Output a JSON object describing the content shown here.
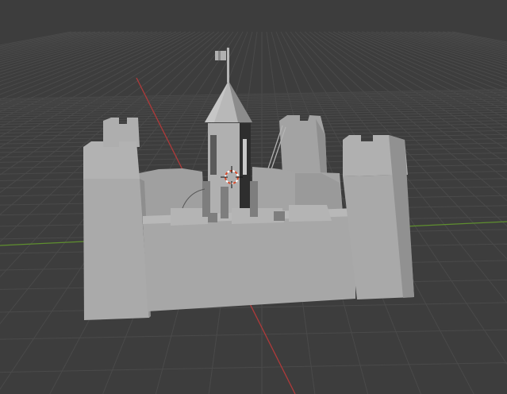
{
  "viewport": {
    "background": "#3d3d3d",
    "grid_color": "#4a4a4a",
    "x_axis_color": "#b03a3a",
    "y_axis_color": "#5f8f2f",
    "model_color": "#a9a9a9",
    "model_shadow_color": "#8a8a8a",
    "model_highlight_color": "#bdbdbd"
  }
}
